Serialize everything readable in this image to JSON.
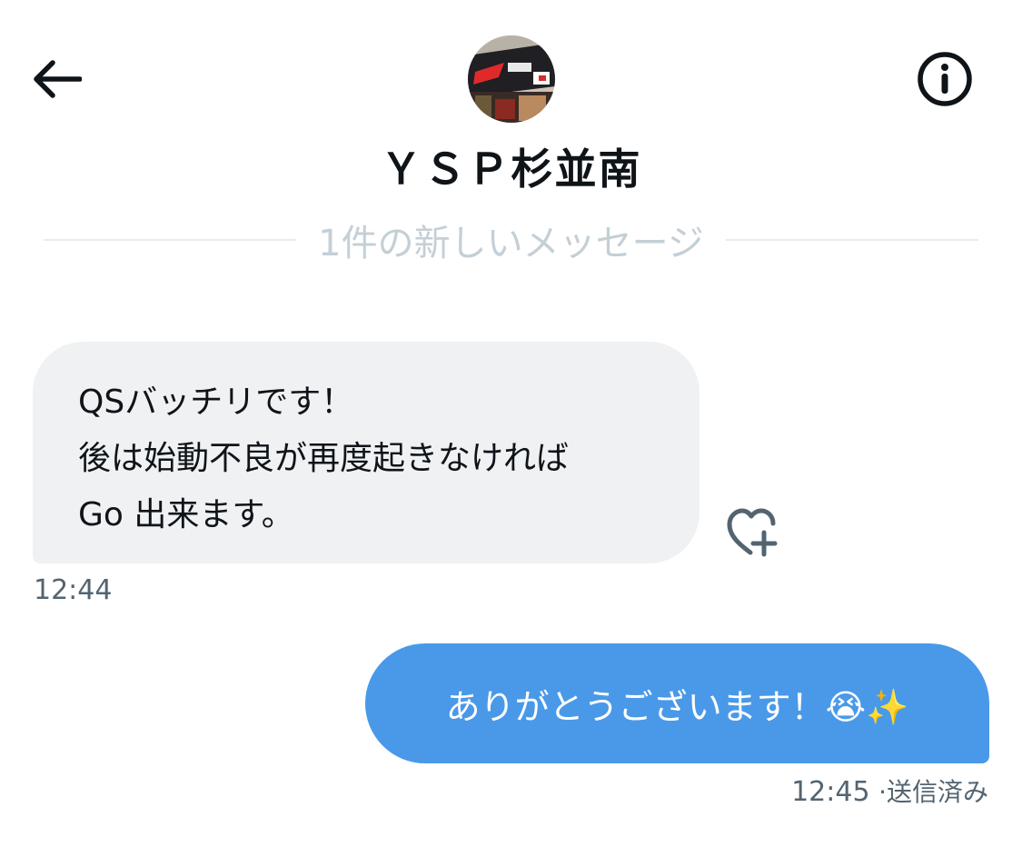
{
  "header": {
    "chat_name": "ＹＳＰ杉並南",
    "back_icon": "arrow-left-icon",
    "info_icon": "info-icon"
  },
  "divider": {
    "label": "1件の新しいメッセージ"
  },
  "messages": [
    {
      "direction": "incoming",
      "lines": [
        "QSバッチリです！",
        "後は始動不良が再度起きなければ",
        "Go 出来ます。"
      ],
      "time": "12:44",
      "reaction_icon": "heart-plus-icon"
    },
    {
      "direction": "outgoing",
      "text": "ありがとうございます！😭✨",
      "time": "12:45",
      "status": "·送信済み"
    }
  ],
  "colors": {
    "incoming_bubble": "#eff1f3",
    "outgoing_bubble": "#4a99e9",
    "muted_text": "#536471",
    "divider_text": "#c4cfd6"
  }
}
